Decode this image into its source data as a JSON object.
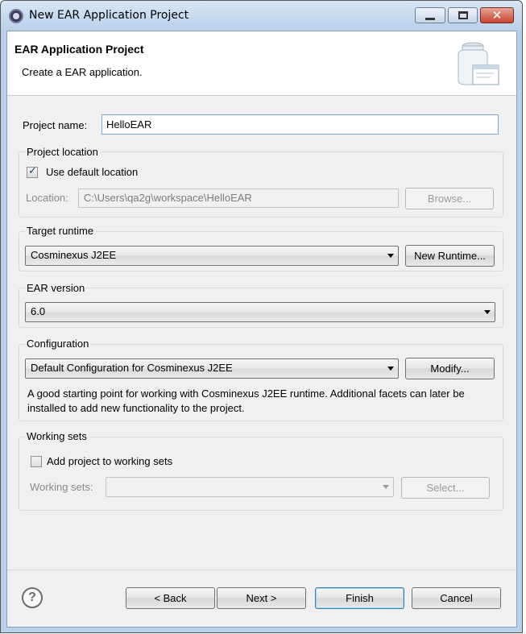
{
  "window": {
    "title": "New EAR Application Project"
  },
  "banner": {
    "title": "EAR Application Project",
    "description": "Create a EAR application."
  },
  "project_name": {
    "label": "Project name:",
    "value": "HelloEAR"
  },
  "project_location": {
    "group_title": "Project location",
    "use_default_label": "Use default location",
    "use_default_checked": true,
    "location_label": "Location:",
    "location_value": "C:\\Users\\qa2g\\workspace\\HelloEAR",
    "browse_label": "Browse..."
  },
  "target_runtime": {
    "group_title": "Target runtime",
    "selected": "Cosminexus J2EE",
    "new_runtime_label": "New Runtime..."
  },
  "ear_version": {
    "group_title": "EAR version",
    "selected": "6.0"
  },
  "configuration": {
    "group_title": "Configuration",
    "selected": "Default Configuration for Cosminexus J2EE",
    "modify_label": "Modify...",
    "description": "A good starting point for working with Cosminexus J2EE runtime. Additional facets can later be installed to add new functionality to the project."
  },
  "working_sets": {
    "group_title": "Working sets",
    "add_label": "Add project to working sets",
    "add_checked": false,
    "sets_label": "Working sets:",
    "sets_value": "",
    "select_label": "Select..."
  },
  "footer": {
    "help_glyph": "?",
    "back_label": "< Back",
    "next_label": "Next >",
    "finish_label": "Finish",
    "cancel_label": "Cancel"
  },
  "icons": {
    "app": "eclipse-icon",
    "help": "help-icon",
    "banner": "ear-jar-icon"
  },
  "colors": {
    "title_bar": "#b9d1ea",
    "dialog_bg": "#f0f0f0",
    "close_button": "#c7442e",
    "input_focus_border": "#7aa7d6"
  }
}
